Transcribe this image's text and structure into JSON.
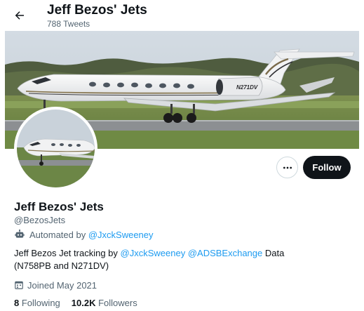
{
  "header": {
    "title": "Jeff Bezos' Jets",
    "tweet_count": "788 Tweets"
  },
  "banner": {
    "tail_number": "N271DV"
  },
  "profile": {
    "name": "Jeff Bezos' Jets",
    "handle": "@BezosJets",
    "automated_prefix": "Automated by",
    "automated_by": "@JxckSweeney",
    "bio": {
      "text_1": "Jeff Bezos Jet tracking by",
      "mention_1": "@JxckSweeney",
      "mention_2": "@ADSBExchange",
      "text_2": "Data",
      "text_3": "(N758PB and N271DV)"
    },
    "joined": "Joined May 2021"
  },
  "stats": {
    "following_count": "8",
    "following_label": "Following",
    "followers_count": "10.2K",
    "followers_label": "Followers"
  },
  "actions": {
    "follow_label": "Follow"
  },
  "icons": {
    "back": "arrow-left-icon",
    "more": "more-horizontal-icon",
    "bot": "bot-icon",
    "calendar": "calendar-icon"
  },
  "colors": {
    "link": "#1d9bf0",
    "text": "#0f1419",
    "muted": "#536471",
    "follow_bg": "#0f1419"
  }
}
